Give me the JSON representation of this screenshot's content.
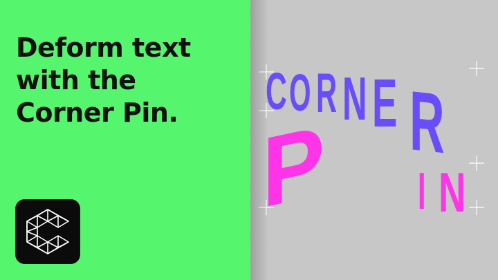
{
  "headline": {
    "lines": [
      "Deform text",
      "with the",
      "Corner Pin."
    ]
  },
  "artwork": {
    "word_top": "CORNER",
    "word_bottom": "PIN",
    "word_top_letters": [
      "C",
      "O",
      "R",
      "N",
      "E",
      "R"
    ],
    "word_bottom_letters": [
      "P",
      "I",
      "N"
    ]
  },
  "icons": {
    "logo": "cavalry-c-logo-icon",
    "pin_handle": "corner-pin-handle-icon"
  },
  "colors": {
    "left_background": "#56F56E",
    "right_background": "#C7C7C7",
    "headline_text": "#111111",
    "logo_tile": "#0B0B0B",
    "word_top": "#6A4DFA",
    "word_bottom": "#FF34E8",
    "handles": "#FFFFFF"
  }
}
